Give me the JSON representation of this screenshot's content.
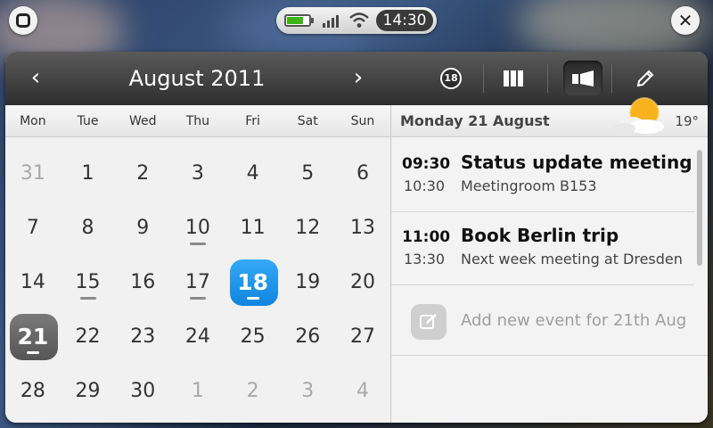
{
  "system": {
    "clock": "14:30",
    "battery_level": 0.75,
    "signal_bars": 4,
    "wifi": true
  },
  "toolbar": {
    "month_title": "August 2011",
    "prev_arrow": "‹",
    "next_arrow": "›",
    "today_badge": "18",
    "active_view": "day-view"
  },
  "calendar": {
    "weekdays": [
      "Mon",
      "Tue",
      "Wed",
      "Thu",
      "Fri",
      "Sat",
      "Sun"
    ],
    "weeks": [
      [
        {
          "d": "31",
          "muted": true
        },
        {
          "d": "1"
        },
        {
          "d": "2"
        },
        {
          "d": "3"
        },
        {
          "d": "4"
        },
        {
          "d": "5"
        },
        {
          "d": "6"
        }
      ],
      [
        {
          "d": "7"
        },
        {
          "d": "8"
        },
        {
          "d": "9"
        },
        {
          "d": "10",
          "event": true
        },
        {
          "d": "11"
        },
        {
          "d": "12"
        },
        {
          "d": "13"
        }
      ],
      [
        {
          "d": "14"
        },
        {
          "d": "15",
          "event": true
        },
        {
          "d": "16"
        },
        {
          "d": "17",
          "event": true
        },
        {
          "d": "18",
          "today": true
        },
        {
          "d": "19"
        },
        {
          "d": "20"
        }
      ],
      [
        {
          "d": "21",
          "selected": true
        },
        {
          "d": "22"
        },
        {
          "d": "23"
        },
        {
          "d": "24"
        },
        {
          "d": "25"
        },
        {
          "d": "26"
        },
        {
          "d": "27"
        }
      ],
      [
        {
          "d": "28"
        },
        {
          "d": "29"
        },
        {
          "d": "30"
        },
        {
          "d": "1",
          "muted": true
        },
        {
          "d": "2",
          "muted": true
        },
        {
          "d": "3",
          "muted": true
        },
        {
          "d": "4",
          "muted": true
        }
      ]
    ]
  },
  "agenda": {
    "date": "Monday 21 August",
    "temperature": "19°",
    "events": [
      {
        "start": "09:30",
        "end": "10:30",
        "title": "Status update meeting",
        "location": "Meetingroom B153"
      },
      {
        "start": "11:00",
        "end": "13:30",
        "title": "Book Berlin trip",
        "location": "Next week meeting at Dresden"
      }
    ],
    "add_label": "Add new event for 21th Aug"
  },
  "colors": {
    "today": "#1a90e6",
    "selected": "#666666",
    "toolbar": "#3c3c3c",
    "battery": "#3cb416"
  }
}
